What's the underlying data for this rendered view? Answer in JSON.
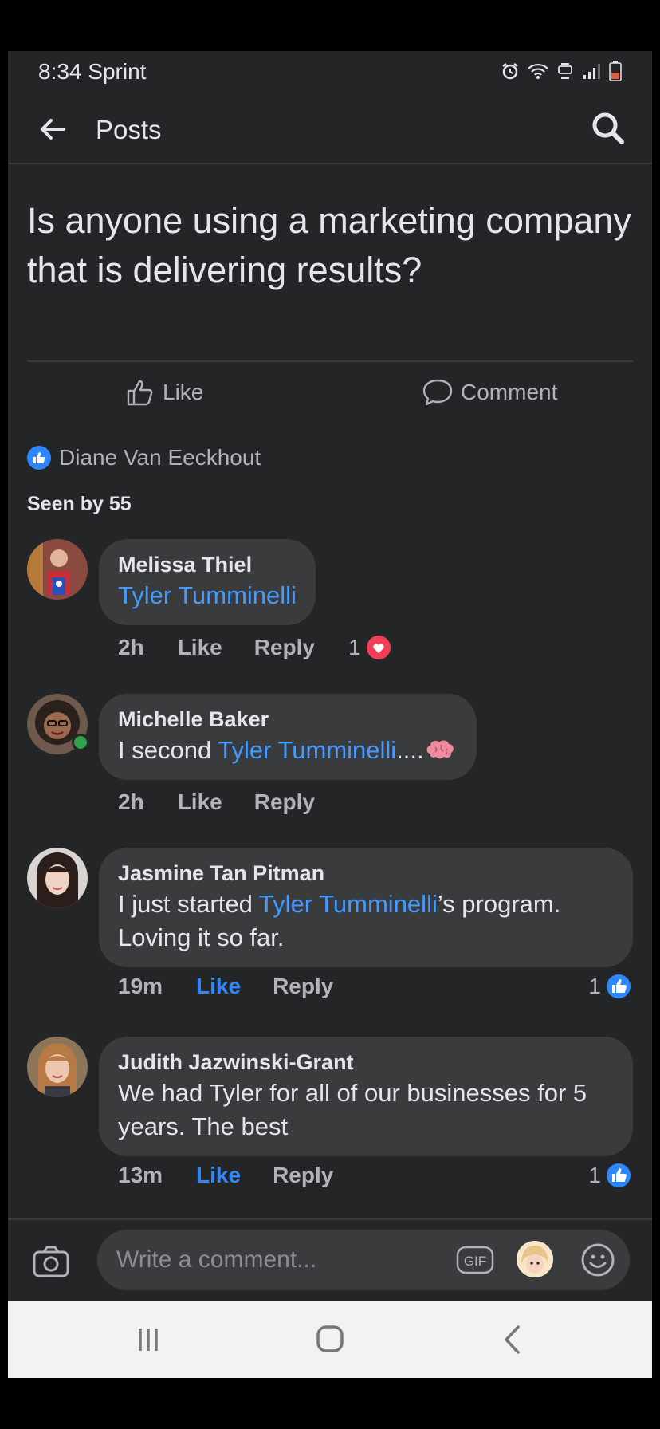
{
  "status_bar": {
    "time_carrier": "8:34 Sprint",
    "icons": [
      "alarm-icon",
      "wifi-icon",
      "volte-icon",
      "signal-icon",
      "battery-icon"
    ]
  },
  "header": {
    "title": "Posts",
    "back_icon": "arrow-left-icon",
    "search_icon": "search-icon"
  },
  "post": {
    "text": "Is anyone using a marketing company that is delivering results?",
    "like_label": "Like",
    "comment_label": "Comment",
    "reactor": "Diane Van Eeckhout",
    "seen": "Seen by 55"
  },
  "comments": [
    {
      "name": "Melissa Thiel",
      "text_before": "",
      "mention": "Tyler Tumminelli",
      "text_after": "",
      "time": "2h",
      "like_label": "Like",
      "reply_label": "Reply",
      "reaction_count": "1",
      "reaction_icon": "heart-icon",
      "liked": false,
      "online": false
    },
    {
      "name": "Michelle Baker",
      "text_before": "I second ",
      "mention": "Tyler Tumminelli",
      "text_after": "....",
      "emoji": "brain-emoji",
      "time": "2h",
      "like_label": "Like",
      "reply_label": "Reply",
      "liked": false,
      "online": true
    },
    {
      "name": "Jasmine Tan Pitman",
      "text_before": "I just started ",
      "mention": "Tyler Tumminelli",
      "text_after": "’s program. Loving it so far.",
      "time": "19m",
      "like_label": "Like",
      "reply_label": "Reply",
      "reaction_count": "1",
      "reaction_icon": "thumbs-up-icon",
      "liked": true,
      "online": false
    },
    {
      "name": "Judith Jazwinski-Grant",
      "text_before": "We had Tyler for all of our businesses for 5 years. The best",
      "mention": "",
      "text_after": "",
      "time": "13m",
      "like_label": "Like",
      "reply_label": "Reply",
      "reaction_count": "1",
      "reaction_icon": "thumbs-up-icon",
      "liked": true,
      "online": false
    }
  ],
  "composer": {
    "placeholder": "Write a comment...",
    "gif_label": "GIF"
  },
  "colors": {
    "background": "#242526",
    "bubble": "#3a3b3c",
    "link": "#4599ff",
    "accent": "#2d88ff"
  }
}
